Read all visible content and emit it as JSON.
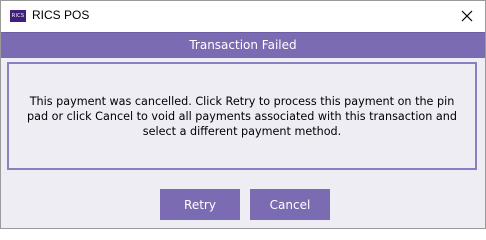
{
  "window": {
    "title": "RICS POS",
    "logo_text": "RICS"
  },
  "banner": {
    "title": "Transaction Failed"
  },
  "message": {
    "text": "This payment was cancelled.  Click Retry to process this payment on the pin\npad or click Cancel to void all payments associated with this transaction and\nselect a different payment method."
  },
  "buttons": {
    "retry_label": "Retry",
    "cancel_label": "Cancel"
  },
  "icons": {
    "close": "close-icon",
    "logo": "rics-logo"
  },
  "colors": {
    "accent": "#7a6bb3",
    "panel_background": "#eeedf4",
    "message_border": "#8a80c0",
    "logo": "#3f1f7a"
  }
}
